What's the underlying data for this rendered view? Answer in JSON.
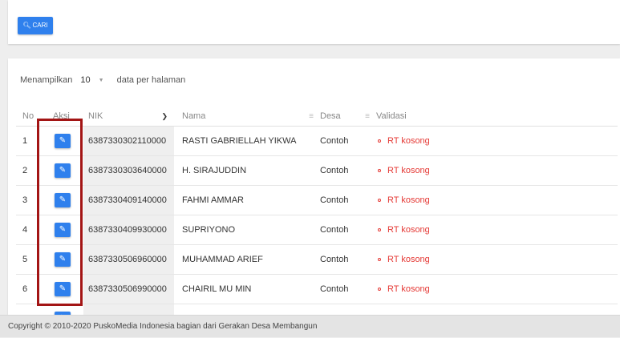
{
  "search": {
    "label": "CARI",
    "icon": "search-icon"
  },
  "pagination": {
    "prefix": "Menampilkan",
    "per_page": "10",
    "suffix": "data per halaman"
  },
  "table": {
    "headers": {
      "no": "No",
      "aksi": "Aksi",
      "nik": "NIK",
      "nama": "Nama",
      "desa": "Desa",
      "validasi": "Validasi"
    },
    "rows": [
      {
        "no": "1",
        "nik": "6387330302110000",
        "nama": "RASTI GABRIELLAH YIKWA",
        "desa": "Contoh",
        "validasi": "RT kosong"
      },
      {
        "no": "2",
        "nik": "6387330303640000",
        "nama": "H. SIRAJUDDIN",
        "desa": "Contoh",
        "validasi": "RT kosong"
      },
      {
        "no": "3",
        "nik": "6387330409140000",
        "nama": "FAHMI AMMAR",
        "desa": "Contoh",
        "validasi": "RT kosong"
      },
      {
        "no": "4",
        "nik": "6387330409930000",
        "nama": "SUPRIYONO",
        "desa": "Contoh",
        "validasi": "RT kosong"
      },
      {
        "no": "5",
        "nik": "6387330506960000",
        "nama": "MUHAMMAD ARIEF",
        "desa": "Contoh",
        "validasi": "RT kosong"
      },
      {
        "no": "6",
        "nik": "6387330506990000",
        "nama": "CHAIRIL MU MIN",
        "desa": "Contoh",
        "validasi": "RT kosong"
      }
    ]
  },
  "footer": {
    "text": "Copyright © 2010-2020 PuskoMedia Indonesia bagian dari Gerakan Desa Membangun"
  },
  "colors": {
    "accent": "#2f80ed",
    "error": "#e53935",
    "highlight": "#a31515"
  }
}
